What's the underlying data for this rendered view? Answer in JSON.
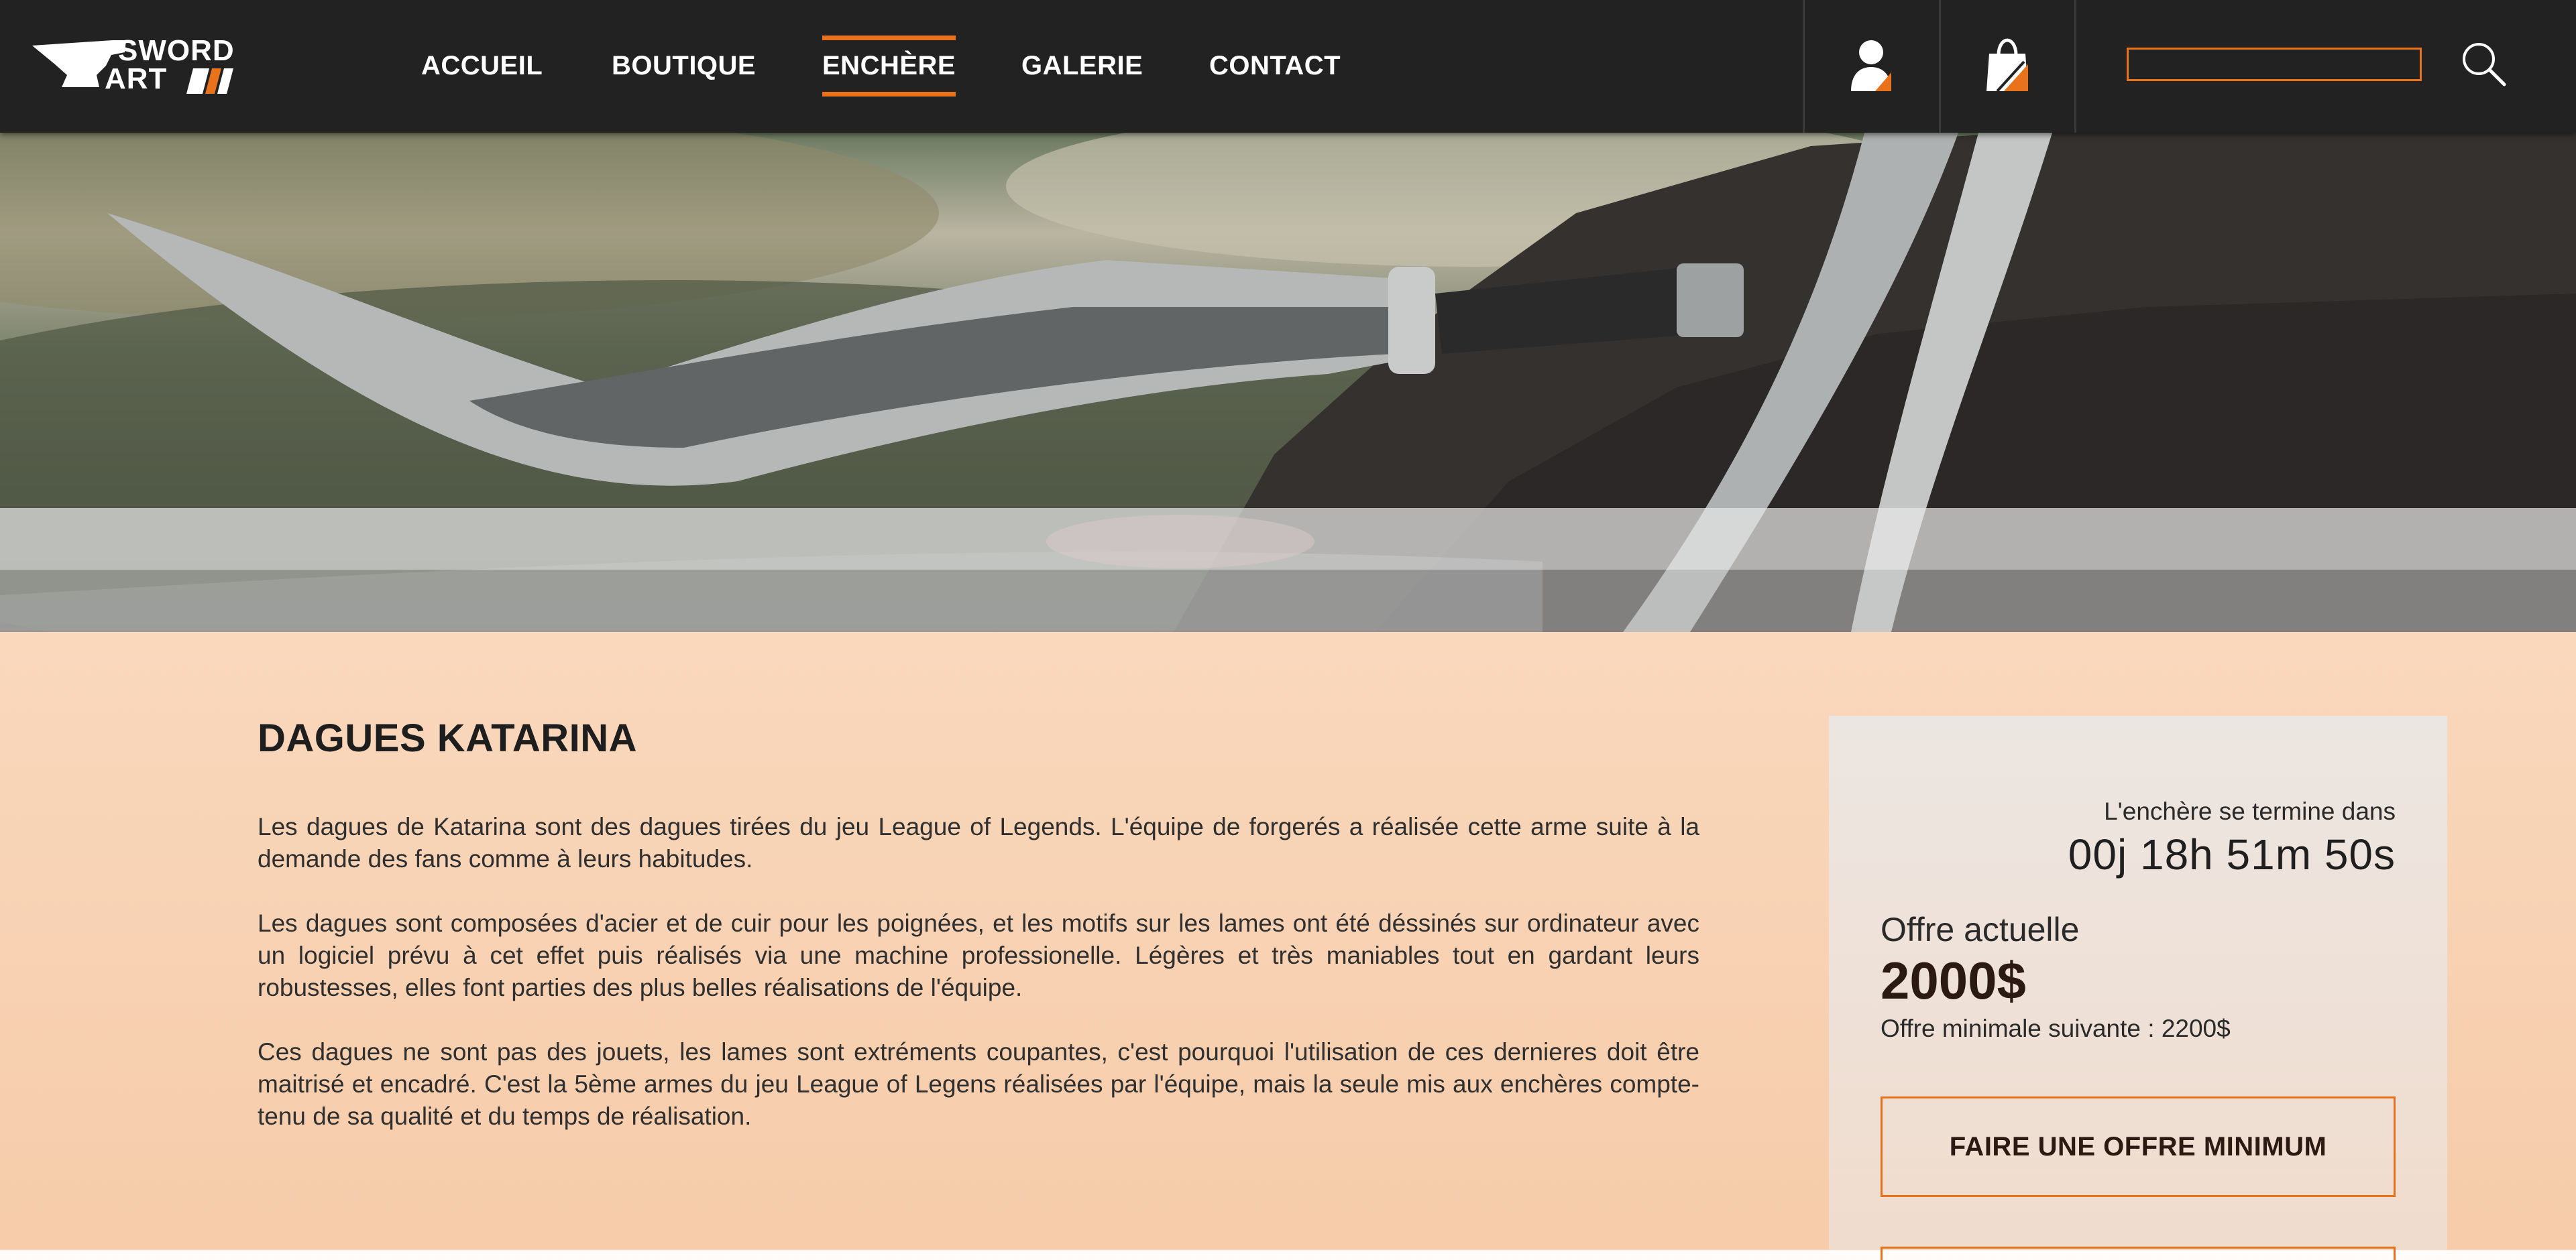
{
  "brand": {
    "line1": "SWORD",
    "line2": "ART"
  },
  "nav": {
    "items": [
      {
        "label": "ACCUEIL"
      },
      {
        "label": "BOUTIQUE"
      },
      {
        "label": "ENCHÈRE",
        "active": true
      },
      {
        "label": "GALERIE"
      },
      {
        "label": "CONTACT"
      }
    ],
    "icons": [
      "user-icon",
      "shopping-bag-icon",
      "search-icon"
    ],
    "search": {
      "value": "",
      "placeholder": ""
    }
  },
  "colors": {
    "accent": "#e8731c",
    "navbar": "#222222",
    "text": "#1e1e1e"
  },
  "product": {
    "title": "DAGUES KATARINA",
    "paragraphs": [
      "Les dagues de Katarina sont des dagues tirées du jeu League of Legends. L'équipe de forgerés a réalisée cette arme suite à la demande des fans comme à leurs habitudes.",
      "Les dagues sont composées d'acier et de cuir pour les poignées, et les motifs sur les lames ont été déssinés sur ordinateur avec un logiciel prévu à cet effet puis réalisés via une machine professionelle. Légères et très maniables tout en gardant leurs robustesses, elles font parties des plus belles réalisations de l'équipe.",
      "Ces dagues ne sont pas des jouets, les lames sont extréments coupantes, c'est pourquoi l'utilisation de ces dernieres doit être maitrisé et encadré. C'est la 5ème armes du jeu League of Legens réalisées par l'équipe, mais la seule mis aux enchères compte-tenu de sa qualité et du temps de réalisation."
    ]
  },
  "auction": {
    "ends_label": "L'enchère se termine dans",
    "countdown": "00j 18h 51m 50s",
    "current_offer_label": "Offre actuelle",
    "current_offer": "2000$",
    "next_min": "Offre minimale suivante : 2200$",
    "button_label": "FAIRE UNE OFFRE MINIMUM"
  }
}
